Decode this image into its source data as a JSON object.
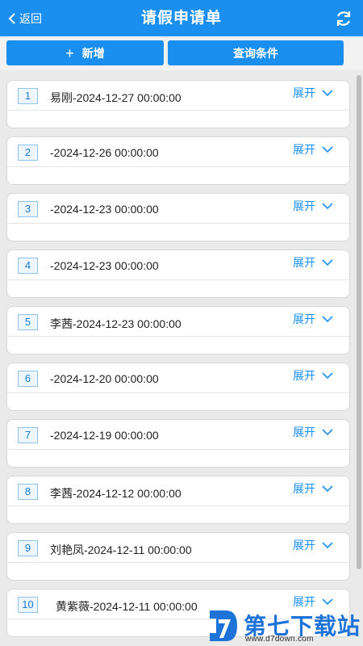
{
  "header": {
    "back_label": "返回",
    "title": "请假申请单",
    "refresh_icon": "refresh-icon"
  },
  "actions": {
    "add_label": "新增",
    "query_label": "查询条件"
  },
  "list": {
    "expand_label": "展开",
    "items": [
      {
        "num": "1",
        "text": "易刚-2024-12-27 00:00:00"
      },
      {
        "num": "2",
        "text": "-2024-12-26 00:00:00"
      },
      {
        "num": "3",
        "text": "-2024-12-23 00:00:00"
      },
      {
        "num": "4",
        "text": "-2024-12-23 00:00:00"
      },
      {
        "num": "5",
        "text": "李茜-2024-12-23 00:00:00"
      },
      {
        "num": "6",
        "text": "-2024-12-20 00:00:00"
      },
      {
        "num": "7",
        "text": "-2024-12-19 00:00:00"
      },
      {
        "num": "8",
        "text": "李茜-2024-12-12 00:00:00"
      },
      {
        "num": "9",
        "text": "刘艳凤-2024-12-11 00:00:00"
      },
      {
        "num": "10",
        "text": "黄紫薇-2024-12-11 00:00:00"
      }
    ]
  },
  "watermark": {
    "name": "第七下载站",
    "url": "www.d7down.com"
  },
  "colors": {
    "accent": "#1a8ff0",
    "badge_border": "#8fc3ee",
    "list_bg": "#eaeaea"
  }
}
